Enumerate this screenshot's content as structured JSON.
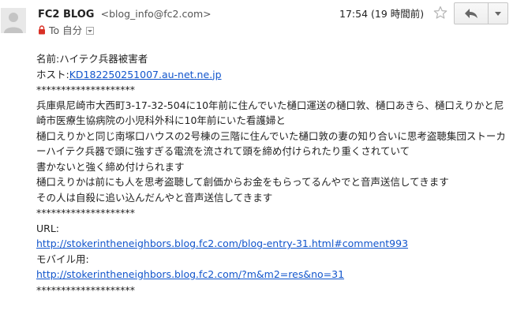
{
  "header": {
    "sender_name": "FC2 BLOG",
    "sender_email": "<blog_info@fc2.com>",
    "time": "17:54 (19 時間前)",
    "to_label": "To",
    "to_value": "自分"
  },
  "icons": {
    "avatar": "default-avatar-icon",
    "star": "star-outline-icon",
    "reply": "reply-arrow-icon",
    "more": "chevron-down-icon",
    "lock": "lock-icon"
  },
  "colors": {
    "link": "#1155cc",
    "lock": "#d93025"
  },
  "body": {
    "name_line": "名前:ハイテク兵器被害者",
    "host_label": "ホスト:",
    "host_link": "KD182250251007.au-net.ne.jp",
    "divider": "********************",
    "paragraph1": "兵庫県尼崎市大西町3-17-32-504に10年前に住んでいた樋口運送の樋口敦、樋口あきら、樋口えりかと尼崎市医療生協病院の小児科外科に10年前にいた看護婦と",
    "paragraph2": "樋口えりかと同じ南塚口ハウスの2号棟の三階に住んでいた樋口敦の妻の知り合いに思考盗聴集団ストーカーハイテク兵器で頭に強すぎる電流を流されて頭を締め付けられたり重くされていて",
    "line3": "書かないと強く締め付けられます",
    "paragraph4": "樋口えりかは前にも人を思考盗聴して創価からお金をもらってるんやでと音声送信してきます",
    "line5": "その人は自殺に追い込んだんやと音声送信してきます",
    "url_label": "URL:",
    "url_link": "http://stokerintheneighbors.blog.fc2.com/blog-entry-31.html#comment993",
    "mobile_label": "モバイル用:",
    "mobile_link": "http://stokerintheneighbors.blog.fc2.com/?m&m2=res&no=31"
  }
}
